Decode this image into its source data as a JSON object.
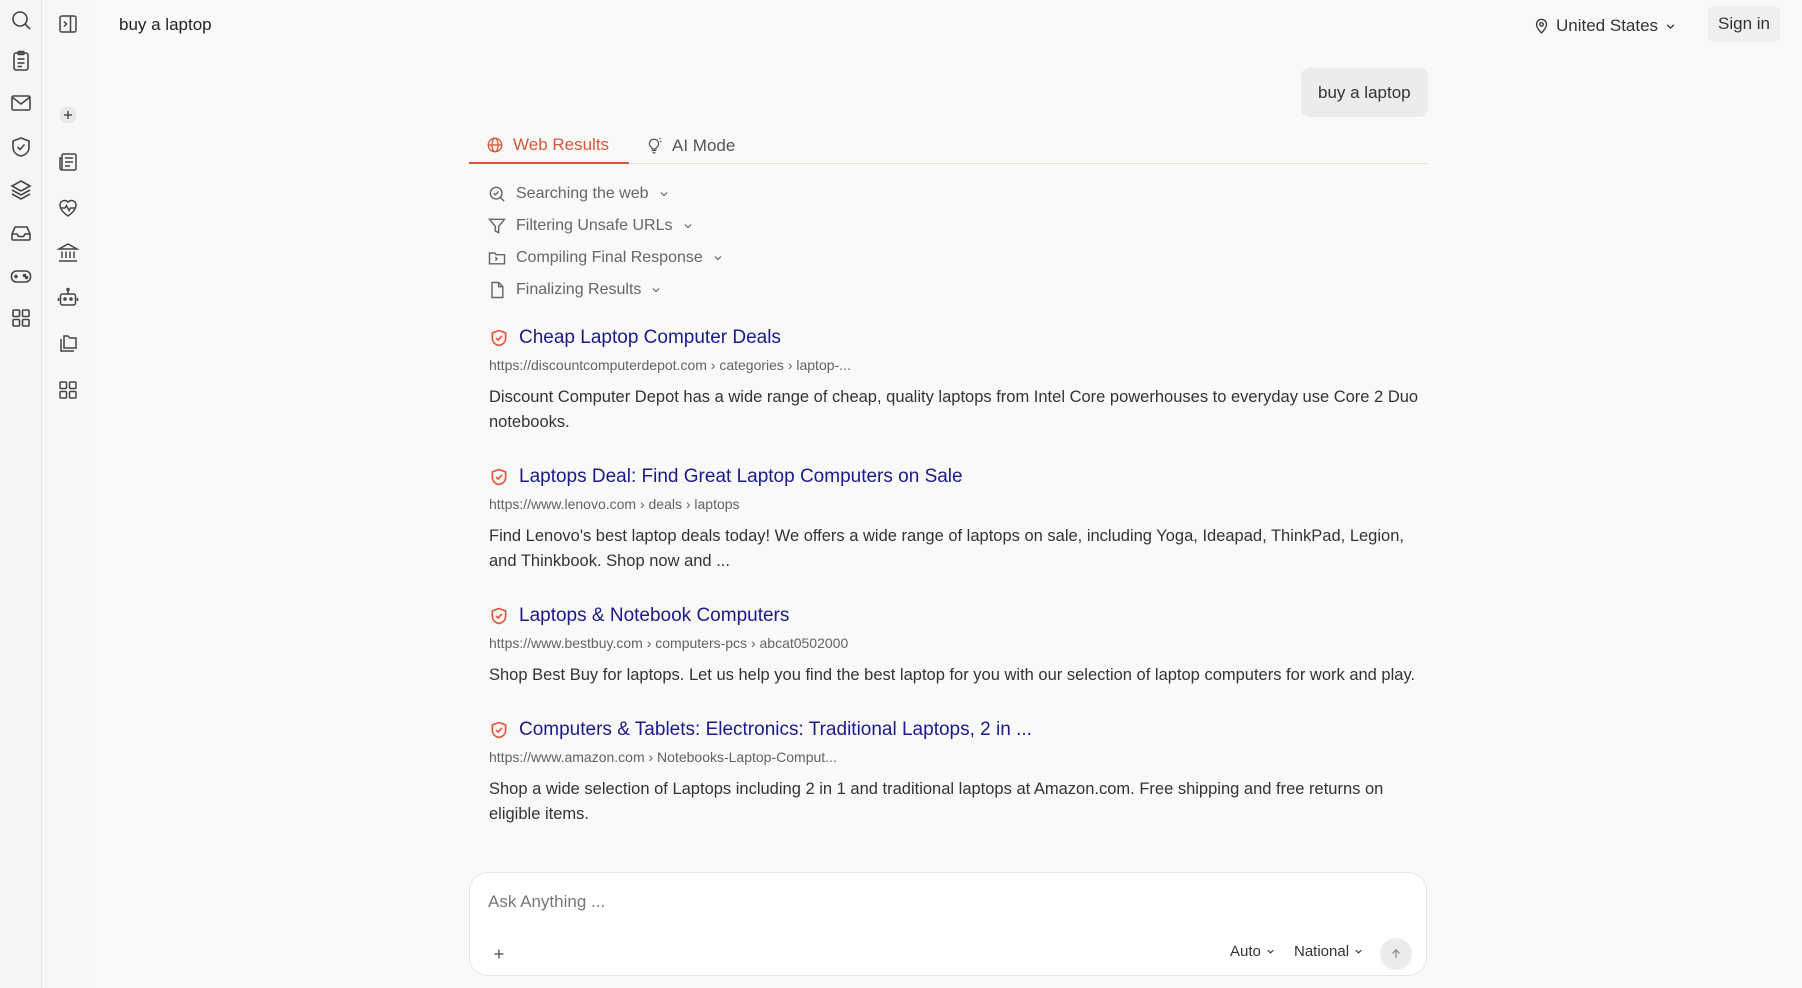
{
  "header": {
    "query_title": "buy a laptop",
    "location": "United States",
    "signin_label": "Sign in"
  },
  "query_bubble": "buy a laptop",
  "tabs": [
    {
      "label": "Web Results",
      "active": true
    },
    {
      "label": "AI Mode",
      "active": false
    }
  ],
  "steps": [
    {
      "label": "Searching the web",
      "icon": "search-check-icon"
    },
    {
      "label": "Filtering Unsafe URLs",
      "icon": "filter-icon"
    },
    {
      "label": "Compiling Final Response",
      "icon": "folder-icon"
    },
    {
      "label": "Finalizing Results",
      "icon": "file-icon"
    }
  ],
  "results": [
    {
      "title": "Cheap Laptop Computer Deals",
      "url": "https://discountcomputerdepot.com › categories › laptop-...",
      "snippet": "Discount Computer Depot has a wide range of cheap, quality laptops from Intel Core powerhouses to everyday use Core 2 Duo notebooks."
    },
    {
      "title": "Laptops Deal: Find Great Laptop Computers on Sale",
      "url": "https://www.lenovo.com › deals › laptops",
      "snippet": "Find Lenovo's best laptop deals today! We offers a wide range of laptops on sale, including Yoga, Ideapad, ThinkPad, Legion, and Thinkbook. Shop now and ..."
    },
    {
      "title": "Laptops & Notebook Computers",
      "url": "https://www.bestbuy.com › computers-pcs › abcat0502000",
      "snippet": "Shop Best Buy for laptops. Let us help you find the best laptop for you with our selection of laptop computers for work and play."
    },
    {
      "title": "Computers & Tablets: Electronics: Traditional Laptops, 2 in ...",
      "url": "https://www.amazon.com › Notebooks-Laptop-Comput...",
      "snippet": "Shop a wide selection of Laptops including 2 in 1 and traditional laptops at Amazon.com. Free shipping and free returns on eligible items."
    }
  ],
  "ask": {
    "placeholder": "Ask Anything ...",
    "mode_auto": "Auto",
    "mode_region": "National"
  },
  "colors": {
    "accent": "#d9573c",
    "link": "#1a1a8c",
    "background": "#f9f9f8"
  }
}
